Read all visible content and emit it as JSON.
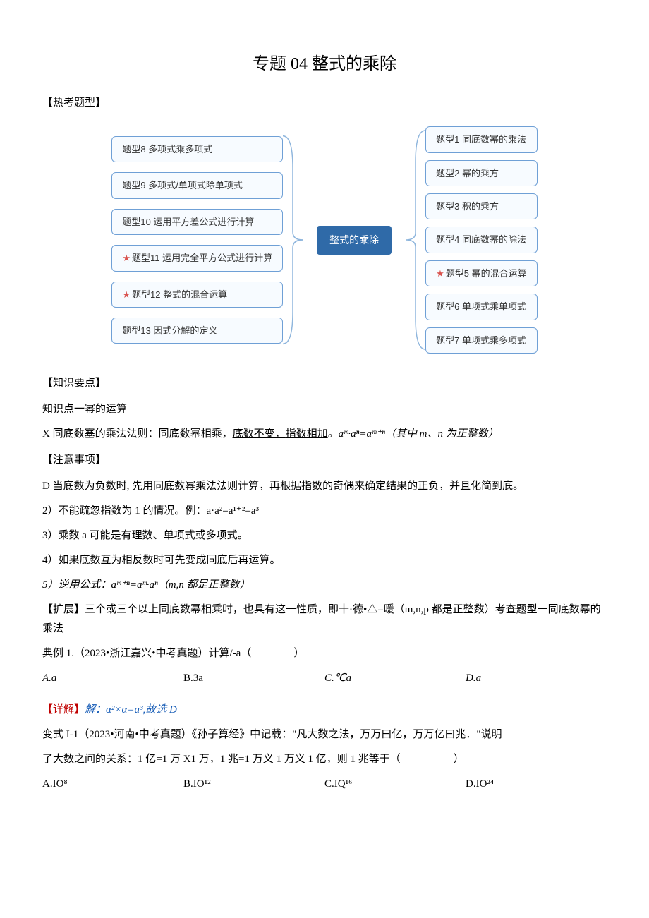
{
  "title": "专题 04 整式的乘除",
  "labels": {
    "hot_types": "【热考题型】",
    "key_points": "【知识要点】",
    "notes": "【注意事项】",
    "extend": "【扩展】",
    "detail_prefix": "【详解】"
  },
  "diagram": {
    "center": "整式的乘除",
    "left": [
      {
        "text": "题型8 多项式乘多项式",
        "star": false
      },
      {
        "text": "题型9 多项式/单项式除单项式",
        "star": false
      },
      {
        "text": "题型10 运用平方差公式进行计算",
        "star": false
      },
      {
        "text": "题型11 运用完全平方公式进行计算",
        "star": true
      },
      {
        "text": "题型12 整式的混合运算",
        "star": true
      },
      {
        "text": "题型13 因式分解的定义",
        "star": false
      }
    ],
    "right": [
      {
        "text": "题型1 同底数幂的乘法",
        "star": false
      },
      {
        "text": "题型2 幂的乘方",
        "star": false
      },
      {
        "text": "题型3 积的乘方",
        "star": false
      },
      {
        "text": "题型4 同底数幂的除法",
        "star": false
      },
      {
        "text": "题型5 幂的混合运算",
        "star": true
      },
      {
        "text": "题型6 单项式乘单项式",
        "star": false
      },
      {
        "text": "题型7 单项式乘多项式",
        "star": false
      }
    ]
  },
  "body": {
    "kp_title": "知识点一幂的运算",
    "rule1_pre": "X 同底数塞的乘法法则：同底数幂相乘，",
    "rule1_u1": "底数不变，",
    "rule1_mid": "",
    "rule1_u2": "指数相加",
    "rule1_post": "。aᵐ·aⁿ=aᵐ⁺ⁿ（其中 m、n 为正整数）",
    "note1": "D 当底数为负数时, 先用同底数幂乘法法则计算，再根据指数的奇偶来确定结果的正负，并且化简到底。",
    "note2": "2）不能疏忽指数为 1 的情况。例：a·a²=a¹⁺²=a³",
    "note3": "3）乘数 a 可能是有理数、单项式或多项式。",
    "note4": "4）如果底数互为相反数时可先变成同底后再运算。",
    "note5": "5）逆用公式：aᵐ⁺ⁿ=aᵐ·aⁿ（m,n 都是正整数）",
    "extend_text": "三个或三个以上同底数幂相乘时，也具有这一性质，即十·德•△=暖（m,n,p 都是正整数）考查题型一同底数幂的乘法",
    "ex1_stem": "典例 1.（2023•浙江嘉兴•中考真题）计算/-a（　　　　）",
    "ex1_opts": {
      "A": "A.a",
      "B": "B.3a",
      "C": "C.℃a",
      "D": "D.a"
    },
    "detail_text": "解：α²×α=a³,故选 D",
    "ex2_stem_a": "变式 I-1（2023•河南•中考真题）《孙子算经》中记载：\"凡大数之法，万万曰亿，万万亿曰兆．\"说明",
    "ex2_stem_b": "了大数之间的关系：1 亿=1 万 X1 万，1 兆=1 万义 1 万义 1 亿，则 1 兆等于（　　　　　）",
    "ex2_opts": {
      "A": "A.IO⁸",
      "B": "B.IO¹²",
      "C": "C.IQ¹⁶",
      "D": "D.IO²⁴"
    }
  }
}
